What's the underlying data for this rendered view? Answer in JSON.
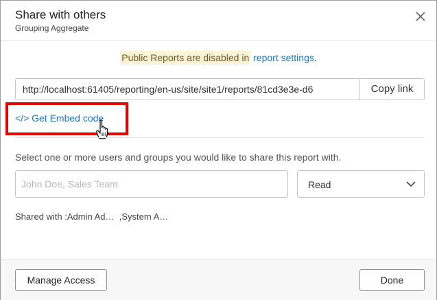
{
  "dialog": {
    "title": "Share with others",
    "subtitle": "Grouping Aggregate",
    "close_icon": "close-icon"
  },
  "notice": {
    "text": "Public Reports are disabled in",
    "link": "report settings",
    "suffix": "."
  },
  "url": {
    "value": "http://localhost:61405/reporting/en-us/site/site1/reports/81cd3e3e-d6",
    "copy_label": "Copy link"
  },
  "embed": {
    "label": "</> Get Embed code",
    "highlight_color": "#e60000"
  },
  "share": {
    "instructions": "Select one or more users and groups you would like to share this report with.",
    "placeholder": "John Doe, Sales Team",
    "permission": "Read",
    "shared_with": "Shared with :Admin Ad…  ,System A…"
  },
  "footer": {
    "manage_label": "Manage Access",
    "done_label": "Done"
  },
  "colors": {
    "link": "#1976d2",
    "notice_bg": "#fbf3d5"
  }
}
